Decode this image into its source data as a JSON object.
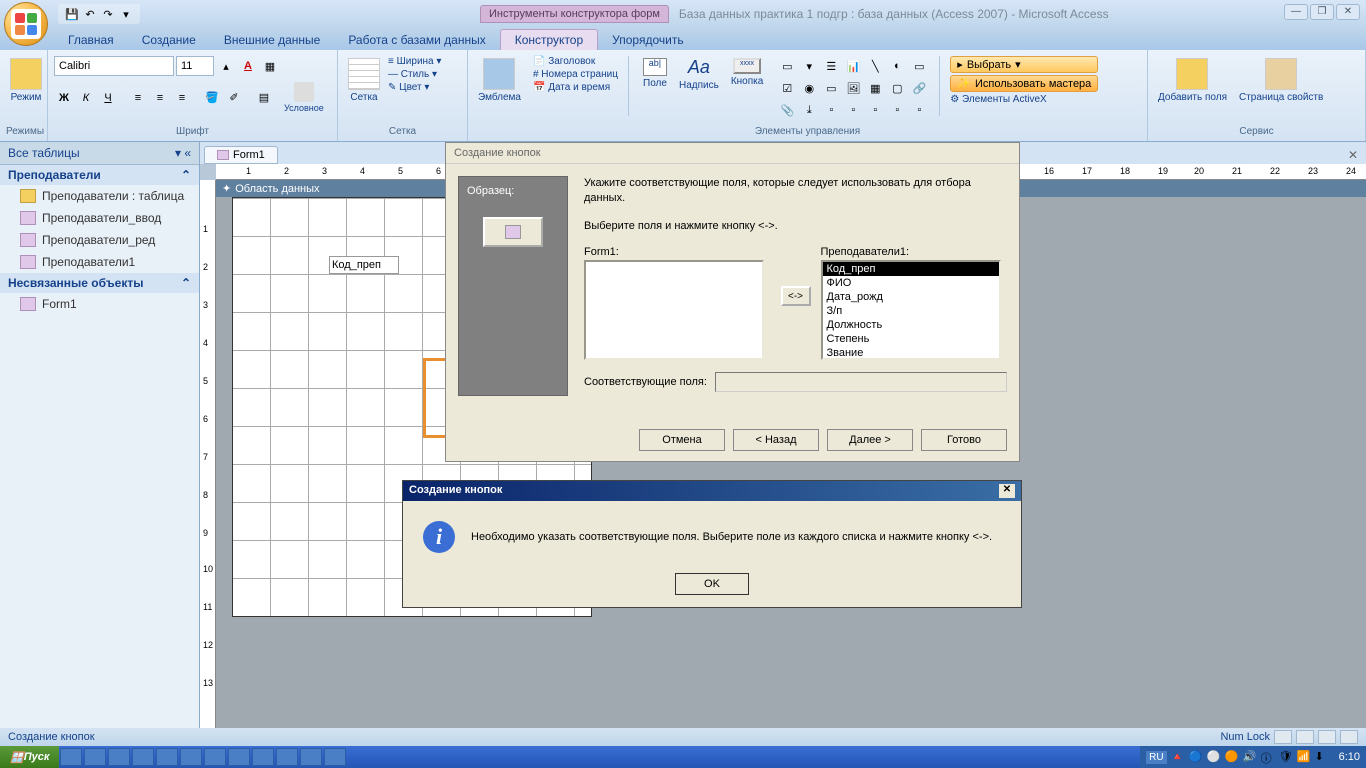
{
  "title": {
    "tool_context": "Инструменты конструктора форм",
    "db_name": "База данных практика 1 подгр : база данных (Access 2007) - Microsoft Access"
  },
  "ribbon_tabs": {
    "home": "Главная",
    "create": "Создание",
    "external": "Внешние данные",
    "dbtools": "Работа с базами данных",
    "constructor": "Конструктор",
    "arrange": "Упорядочить"
  },
  "ribbon": {
    "modes_group": "Режимы",
    "mode_btn": "Режим",
    "font_group": "Шрифт",
    "font_name": "Calibri",
    "font_size": "11",
    "grid_group": "Сетка",
    "grid_btn": "Сетка",
    "conditional": "Условное",
    "width": "Ширина",
    "style": "Стиль",
    "color": "Цвет",
    "emblem": "Эмблема",
    "header": "Заголовок",
    "page_numbers": "Номера страниц",
    "date_time": "Дата и время",
    "controls_group": "Элементы управления",
    "field": "Поле",
    "label": "Надпись",
    "button": "Кнопка",
    "select": "Выбрать",
    "use_wizards": "Использовать мастера",
    "activex": "Элементы ActiveX",
    "add_fields": "Добавить поля",
    "prop_sheet": "Страница свойств",
    "service_group": "Сервис"
  },
  "nav": {
    "all_tables": "Все таблицы",
    "group1": "Преподаватели",
    "item1": "Преподаватели : таблица",
    "item2": "Преподаватели_ввод",
    "item3": "Преподаватели_ред",
    "item4": "Преподаватели1",
    "group2": "Несвязанные объекты",
    "item5": "Form1"
  },
  "doc": {
    "tab": "Form1",
    "section": "Область данных",
    "field_label": "Код_преп"
  },
  "wizard": {
    "title": "Создание кнопок",
    "preview_label": "Образец:",
    "instruction1": "Укажите соответствующие поля, которые следует использовать для отбора данных.",
    "instruction2": "Выберите поля и нажмите кнопку <->.",
    "left_label": "Form1:",
    "right_label": "Преподаватели1:",
    "move_btn": "<->",
    "fields": [
      "Код_преп",
      "ФИО",
      "Дата_рожд",
      "З/п",
      "Должность",
      "Степень",
      "Звание"
    ],
    "corr_fields": "Соответствующие поля:",
    "cancel": "Отмена",
    "back": "< Назад",
    "next": "Далее >",
    "finish": "Готово"
  },
  "alert": {
    "title": "Создание кнопок",
    "message": "Необходимо указать соответствующие поля. Выберите поле из каждого списка и нажмите кнопку <->.",
    "ok": "OK"
  },
  "status": {
    "text": "Создание кнопок",
    "numlock": "Num Lock"
  },
  "taskbar": {
    "start": "Пуск",
    "lang": "RU",
    "time": "6:10"
  }
}
